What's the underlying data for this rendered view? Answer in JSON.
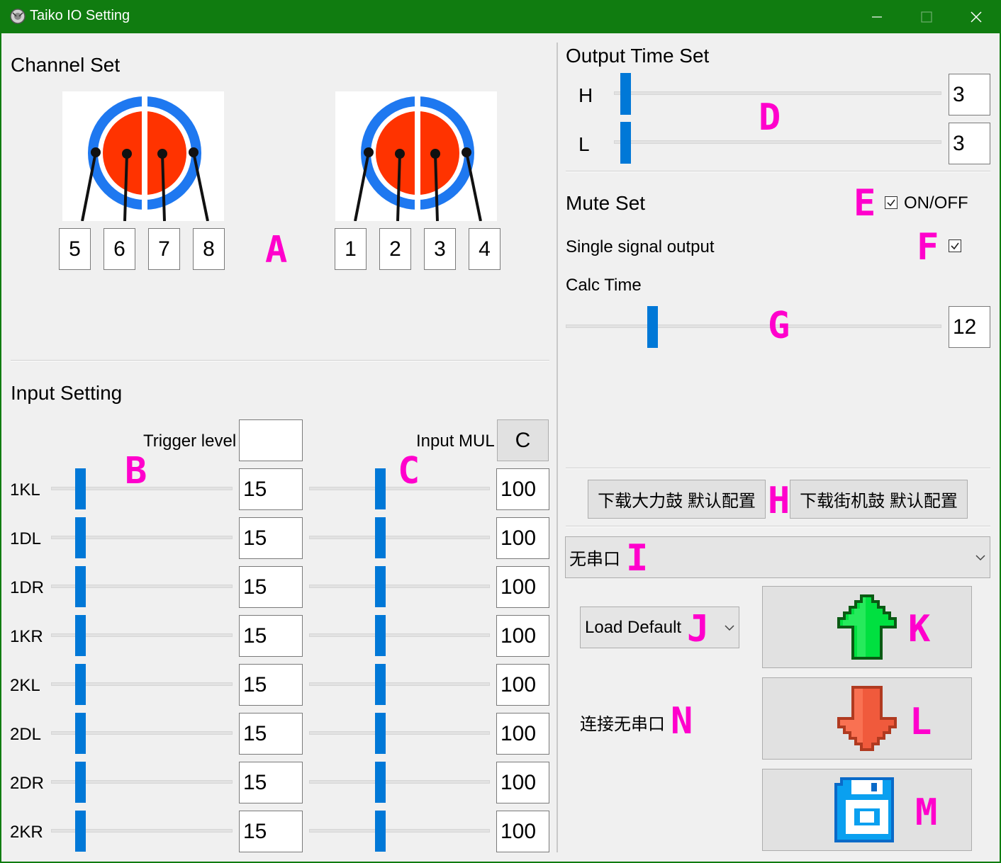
{
  "window": {
    "title": "Taiko IO Setting"
  },
  "channel_set": {
    "heading": "Channel Set",
    "left_channels": [
      "5",
      "6",
      "7",
      "8"
    ],
    "right_channels": [
      "1",
      "2",
      "3",
      "4"
    ],
    "marker": "A"
  },
  "input_setting": {
    "heading": "Input Setting",
    "trigger_label": "Trigger level",
    "trigger_value": "",
    "mul_label": "Input MUL",
    "mul_button": "C",
    "marker_b": "B",
    "marker_c": "C",
    "rows": [
      {
        "label": "1KL",
        "trigger": "15",
        "mul": "100"
      },
      {
        "label": "1DL",
        "trigger": "15",
        "mul": "100"
      },
      {
        "label": "1DR",
        "trigger": "15",
        "mul": "100"
      },
      {
        "label": "1KR",
        "trigger": "15",
        "mul": "100"
      },
      {
        "label": "2KL",
        "trigger": "15",
        "mul": "100"
      },
      {
        "label": "2DL",
        "trigger": "15",
        "mul": "100"
      },
      {
        "label": "2DR",
        "trigger": "15",
        "mul": "100"
      },
      {
        "label": "2KR",
        "trigger": "15",
        "mul": "100"
      }
    ]
  },
  "output_time": {
    "heading": "Output Time Set",
    "h_label": "H",
    "h_value": "3",
    "l_label": "L",
    "l_value": "3",
    "marker": "D"
  },
  "mute_set": {
    "heading": "Mute Set",
    "on_off_label": "ON/OFF",
    "on_off_checked": true,
    "marker_e": "E",
    "single_signal_label": "Single signal output",
    "single_signal_checked": true,
    "marker_f": "F",
    "calc_time_label": "Calc Time",
    "calc_time_value": "12",
    "marker_g": "G"
  },
  "defaults": {
    "download_drum_btn": "下载大力鼓 默认配置",
    "download_arcade_btn": "下载街机鼓 默认配置",
    "marker_h": "H"
  },
  "serial": {
    "port_selected": "无串口",
    "marker_i": "I",
    "load_select": "Load Default",
    "marker_j": "J",
    "status": "连接无串口",
    "marker_n": "N"
  },
  "actions": {
    "marker_k": "K",
    "marker_l": "L",
    "marker_m": "M"
  },
  "colors": {
    "titlebar": "#107c10",
    "slider_thumb": "#0078d7",
    "marker": "#ff00cc",
    "drum_rim": "#1e78f0",
    "drum_face": "#ff3300",
    "upload_arrow": "#00e040",
    "download_arrow": "#f05a3c",
    "save_icon": "#0aa0f0"
  },
  "icons": {
    "app": "taiko-drum-icon",
    "minimize": "minimize-icon",
    "maximize": "maximize-icon",
    "close": "close-icon",
    "upload": "upload-arrow-icon",
    "download": "download-arrow-icon",
    "save": "floppy-save-icon"
  }
}
